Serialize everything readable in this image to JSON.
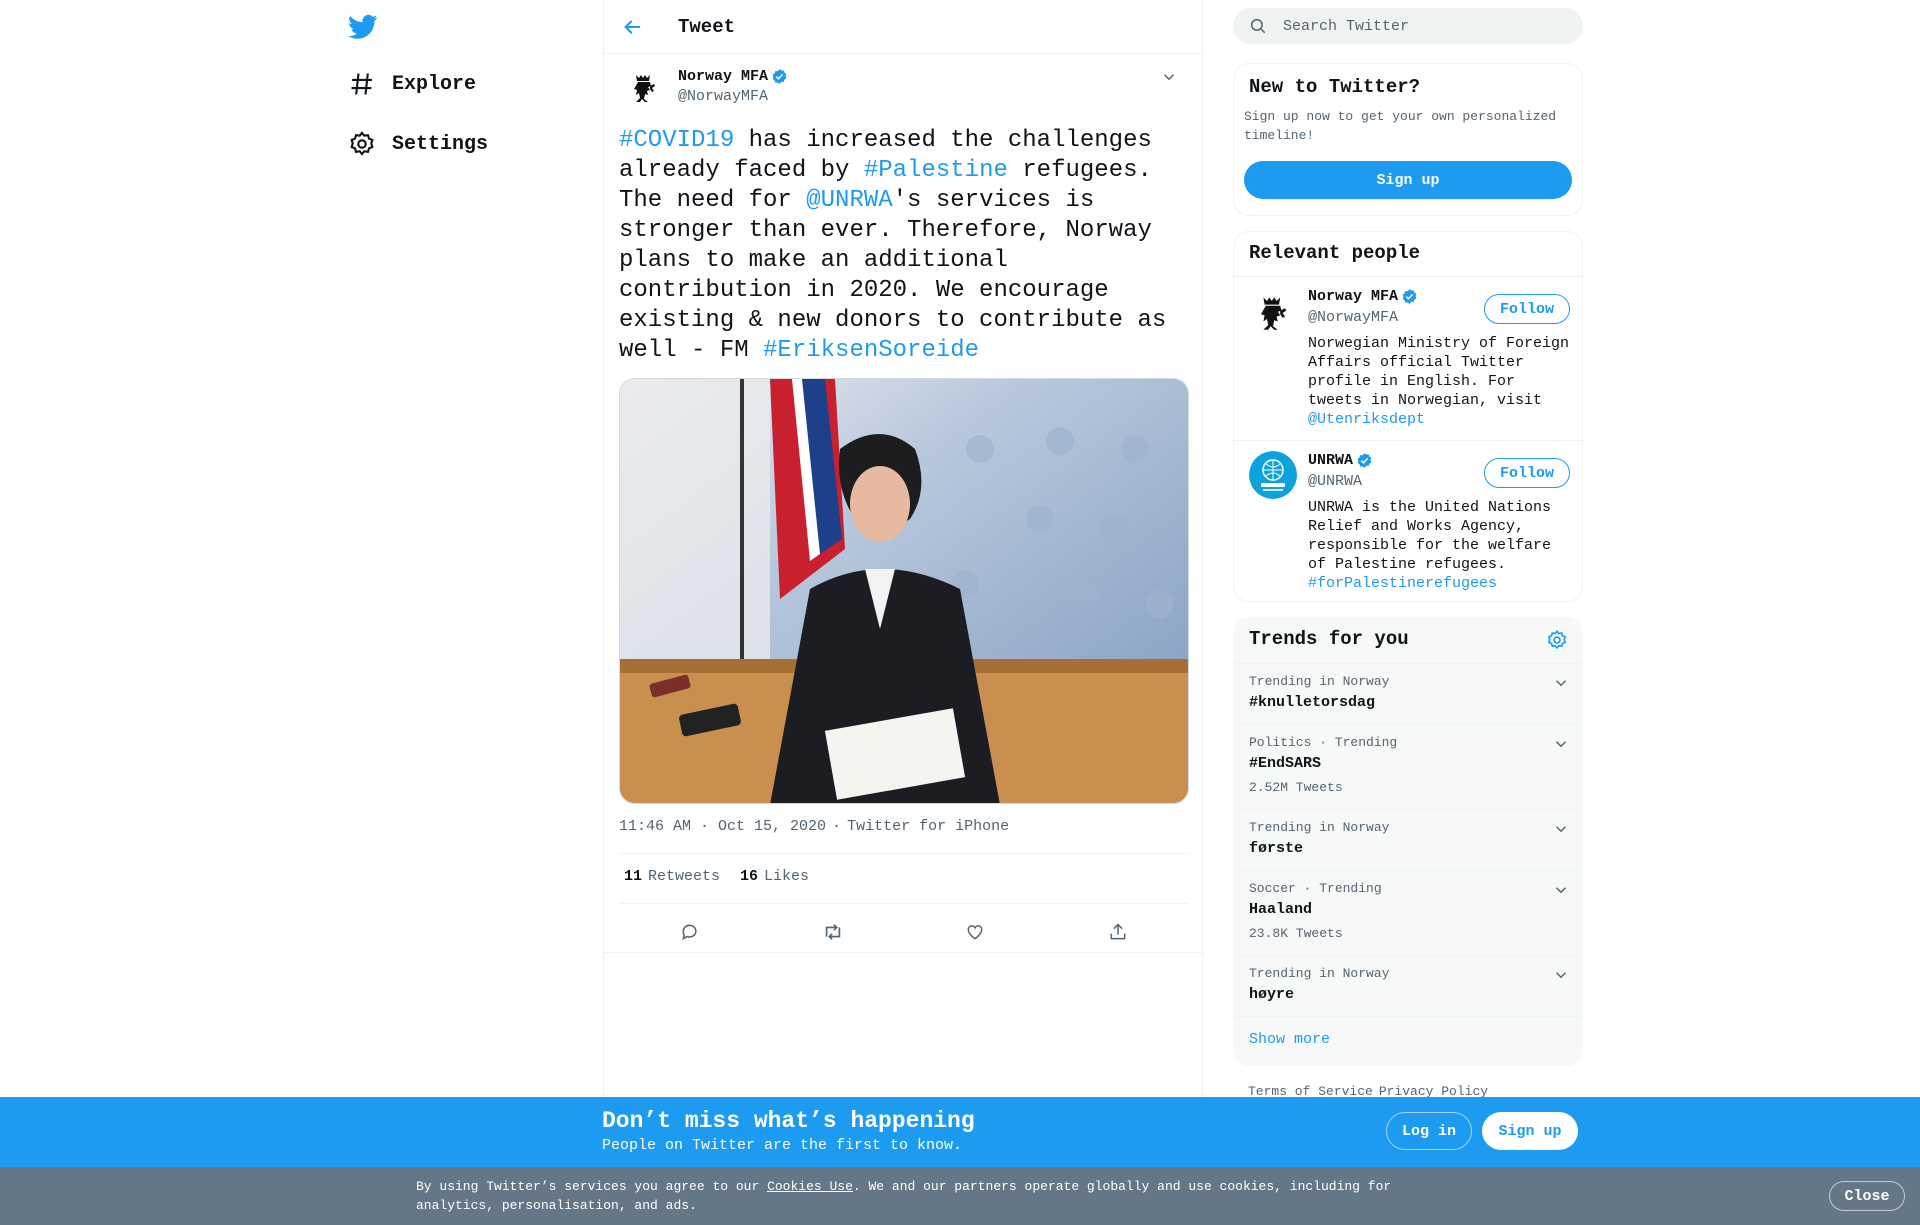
{
  "nav": {
    "items": [
      {
        "label": "Explore",
        "icon": "hashtag-icon"
      },
      {
        "label": "Settings",
        "icon": "gear-icon"
      }
    ]
  },
  "header": {
    "title": "Tweet"
  },
  "tweet": {
    "author_name": "Norway MFA",
    "author_handle": "@NorwayMFA",
    "text_parts": [
      {
        "t": "#COVID19",
        "link": true
      },
      {
        "t": " has increased the challenges already faced by ",
        "link": false
      },
      {
        "t": "#Palestine",
        "link": true
      },
      {
        "t": " refugees. The need for ",
        "link": false
      },
      {
        "t": "@UNRWA",
        "link": true
      },
      {
        "t": "'s services is stronger than ever. Therefore, Norway plans to make an additional contribution in 2020. We encourage existing & new donors to contribute as well - FM ",
        "link": false
      },
      {
        "t": "#EriksenSoreide",
        "link": true
      }
    ],
    "time": "11:46 AM · Oct 15, 2020",
    "source": "Twitter for iPhone",
    "retweets_count": "11",
    "retweets_label": "Retweets",
    "likes_count": "16",
    "likes_label": "Likes"
  },
  "search": {
    "placeholder": "Search Twitter"
  },
  "new_to_twitter": {
    "title": "New to Twitter?",
    "description": "Sign up now to get your own personalized timeline!",
    "button": "Sign up"
  },
  "relevant_people": {
    "title": "Relevant people",
    "people": [
      {
        "name": "Norway MFA",
        "handle": "@NorwayMFA",
        "bio": "Norwegian Ministry of Foreign Affairs official Twitter profile in English. For tweets in Norwegian, visit ",
        "bio_link": "@Utenriksdept",
        "follow": "Follow"
      },
      {
        "name": "UNRWA",
        "handle": "@UNRWA",
        "bio": "UNRWA is the United Nations Relief and Works Agency, responsible for the welfare of Palestine refugees. ",
        "bio_link": "#forPalestinerefugees",
        "follow": "Follow"
      }
    ]
  },
  "trends": {
    "title": "Trends for you",
    "items": [
      {
        "context": "Trending in Norway",
        "name": "#knulletorsdag",
        "count": ""
      },
      {
        "context": "Politics · Trending",
        "name": "#EndSARS",
        "count": "2.52M Tweets"
      },
      {
        "context": "Trending in Norway",
        "name": "første",
        "count": ""
      },
      {
        "context": "Soccer · Trending",
        "name": "Haaland",
        "count": "23.8K Tweets"
      },
      {
        "context": "Trending in Norway",
        "name": "høyre",
        "count": ""
      }
    ],
    "show_more": "Show more"
  },
  "footer": {
    "links": [
      "Terms of Service",
      "Privacy Policy"
    ]
  },
  "banner": {
    "title": "Don’t miss what’s happening",
    "subtitle": "People on Twitter are the first to know.",
    "login": "Log in",
    "signup": "Sign up"
  },
  "cookie": {
    "prefix": "By using Twitter’s services you agree to our ",
    "link": "Cookies Use",
    "suffix": ". We and our partners operate globally and use cookies, including for analytics, personalisation, and ads.",
    "close": "Close"
  },
  "colors": {
    "accent": "#1d9bf0",
    "text": "#0f1419",
    "muted": "#536471",
    "cookie_bg": "#657786"
  }
}
